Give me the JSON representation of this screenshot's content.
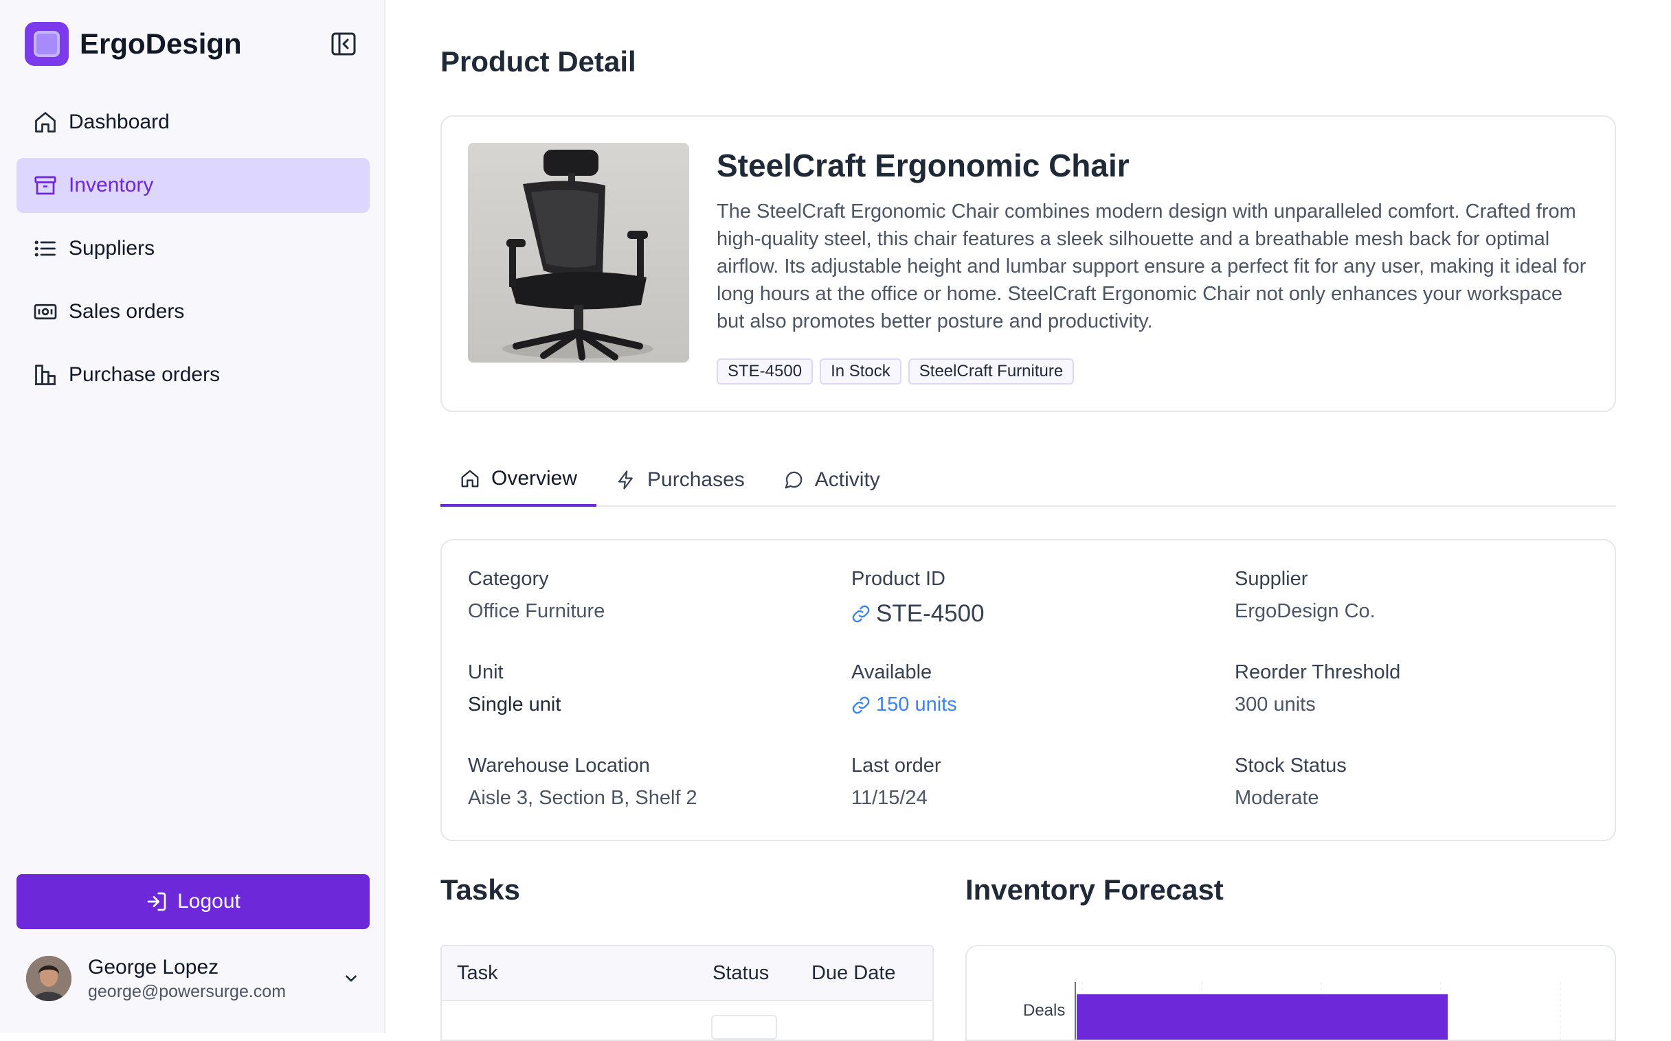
{
  "brand": {
    "name": "ErgoDesign",
    "accent": "#6d28d9"
  },
  "sidebar": {
    "items": [
      {
        "label": "Dashboard",
        "icon": "home-icon"
      },
      {
        "label": "Inventory",
        "icon": "archive-icon",
        "active": true
      },
      {
        "label": "Suppliers",
        "icon": "list-icon"
      },
      {
        "label": "Sales orders",
        "icon": "banknote-icon"
      },
      {
        "label": "Purchase orders",
        "icon": "building-icon"
      }
    ],
    "logout_label": "Logout",
    "user": {
      "name": "George Lopez",
      "email": "george@powersurge.com"
    }
  },
  "page": {
    "title": "Product Detail"
  },
  "product": {
    "name": "SteelCraft Ergonomic Chair",
    "description": "The SteelCraft Ergonomic Chair combines modern design with unparalleled comfort. Crafted from high-quality steel, this chair features a sleek silhouette and a breathable mesh back for optimal airflow. Its adjustable height and lumbar support ensure a perfect fit for any user, making it ideal for long hours at the office or home. SteelCraft Ergonomic Chair not only enhances your workspace but also promotes better posture and productivity.",
    "tags": [
      "STE-4500",
      "In Stock",
      "SteelCraft Furniture"
    ]
  },
  "tabs": [
    {
      "label": "Overview",
      "icon": "home-icon",
      "active": true
    },
    {
      "label": "Purchases",
      "icon": "lightning-icon"
    },
    {
      "label": "Activity",
      "icon": "chat-bubble-icon"
    }
  ],
  "details": {
    "category": {
      "label": "Category",
      "value": "Office Furniture"
    },
    "product_id": {
      "label": "Product ID",
      "value": "STE-4500"
    },
    "supplier": {
      "label": "Supplier",
      "value": "ErgoDesign Co."
    },
    "unit": {
      "label": "Unit",
      "value": "Single unit"
    },
    "available": {
      "label": "Available",
      "value": "150 units"
    },
    "reorder": {
      "label": "Reorder Threshold",
      "value": "300 units"
    },
    "warehouse": {
      "label": "Warehouse Location",
      "value": "Aisle 3, Section B, Shelf 2"
    },
    "last_order": {
      "label": "Last order",
      "value": "11/15/24"
    },
    "stock_status": {
      "label": "Stock Status",
      "value": "Moderate"
    }
  },
  "tasks": {
    "title": "Tasks",
    "columns": [
      "Task",
      "Status",
      "Due Date"
    ]
  },
  "forecast": {
    "title": "Inventory Forecast",
    "row_label": "Deals"
  }
}
